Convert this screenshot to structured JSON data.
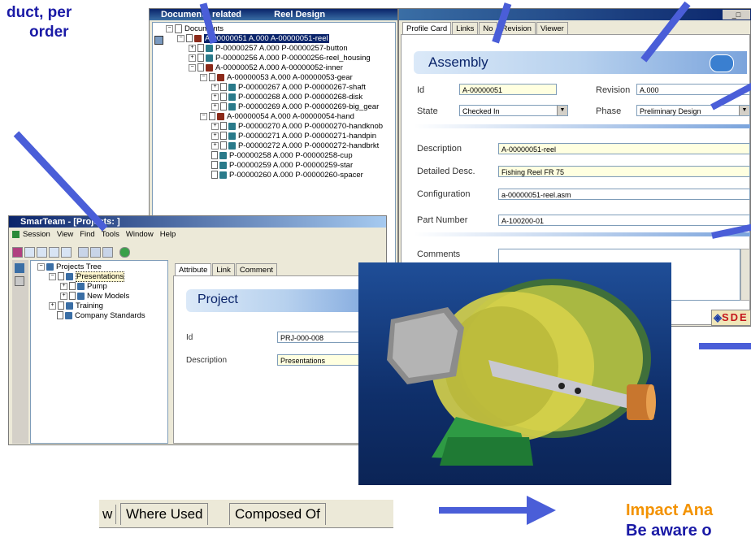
{
  "overlay": {
    "top_left_text_line1": "duct, per",
    "top_left_text_line2": "order",
    "bottom_right_line1": "Impact Ana",
    "bottom_right_line2": "Be aware o"
  },
  "doc_window": {
    "title_left": "Documents related",
    "title_right": "Reel Design",
    "tree": [
      {
        "label": "Documents"
      },
      {
        "label": "A-00000051 A.000 A-00000051-reel",
        "selected": true
      },
      {
        "label": "P-00000257 A.000 P-00000257-button"
      },
      {
        "label": "P-00000256 A.000 P-00000256-reel_housing"
      },
      {
        "label": "A-00000052 A.000 A-00000052-inner"
      },
      {
        "label": "A-00000053 A.000 A-00000053-gear"
      },
      {
        "label": "P-00000267 A.000 P-00000267-shaft"
      },
      {
        "label": "P-00000268 A.000 P-00000268-disk"
      },
      {
        "label": "P-00000269 A.000 P-00000269-big_gear"
      },
      {
        "label": "A-00000054 A.000 A-00000054-hand"
      },
      {
        "label": "P-00000270 A.000 P-00000270-handknob"
      },
      {
        "label": "P-00000271 A.000 P-00000271-handpin"
      },
      {
        "label": "P-00000272 A.000 P-00000272-handbrkt"
      },
      {
        "label": "P-00000258 A.000 P-00000258-cup"
      },
      {
        "label": "P-00000259 A.000 P-00000259-star"
      },
      {
        "label": "P-00000260 A.000 P-00000260-spacer"
      }
    ]
  },
  "profile": {
    "tabs": [
      "Profile Card",
      "Links",
      "No",
      "Revision",
      "Viewer"
    ],
    "header": "Assembly",
    "id_label": "Id",
    "id_value": "A-00000051",
    "revision_label": "Revision",
    "revision_value": "A.000",
    "state_label": "State",
    "state_value": "Checked In",
    "phase_label": "Phase",
    "phase_value": "Preliminary Design",
    "description_label": "Description",
    "description_value": "A-00000051-reel",
    "detailed_label": "Detailed Desc.",
    "detailed_value": "Fishing Reel FR 75",
    "config_label": "Configuration",
    "config_value": "a-00000051-reel.asm",
    "partnum_label": "Part Number",
    "partnum_value": "A-100200-01",
    "comments_label": "Comments",
    "badge": "SDE"
  },
  "smarteam": {
    "title": "SmarTeam - [Projects: ]",
    "menu": [
      "Session",
      "View",
      "Find",
      "Tools",
      "Window",
      "Help"
    ],
    "tree": [
      {
        "label": "Projects Tree"
      },
      {
        "label": "Presentations",
        "selected": true
      },
      {
        "label": "Pump"
      },
      {
        "label": "New Models"
      },
      {
        "label": "Training"
      },
      {
        "label": "Company Standards"
      }
    ],
    "tabs": [
      "Attribute",
      "Link",
      "Comment"
    ],
    "header": "Project",
    "id_label": "Id",
    "id_value": "PRJ-000-008",
    "desc_label": "Description",
    "desc_value": "Presentations"
  },
  "bottom_tabs": {
    "partial": "w",
    "where_used": "Where Used",
    "composed_of": "Composed Of"
  },
  "colors": {
    "arrow": "#4a5ed8",
    "title_bar": "#0a246a",
    "impact_text": "#f39200",
    "aware_text": "#1a1aa6"
  }
}
